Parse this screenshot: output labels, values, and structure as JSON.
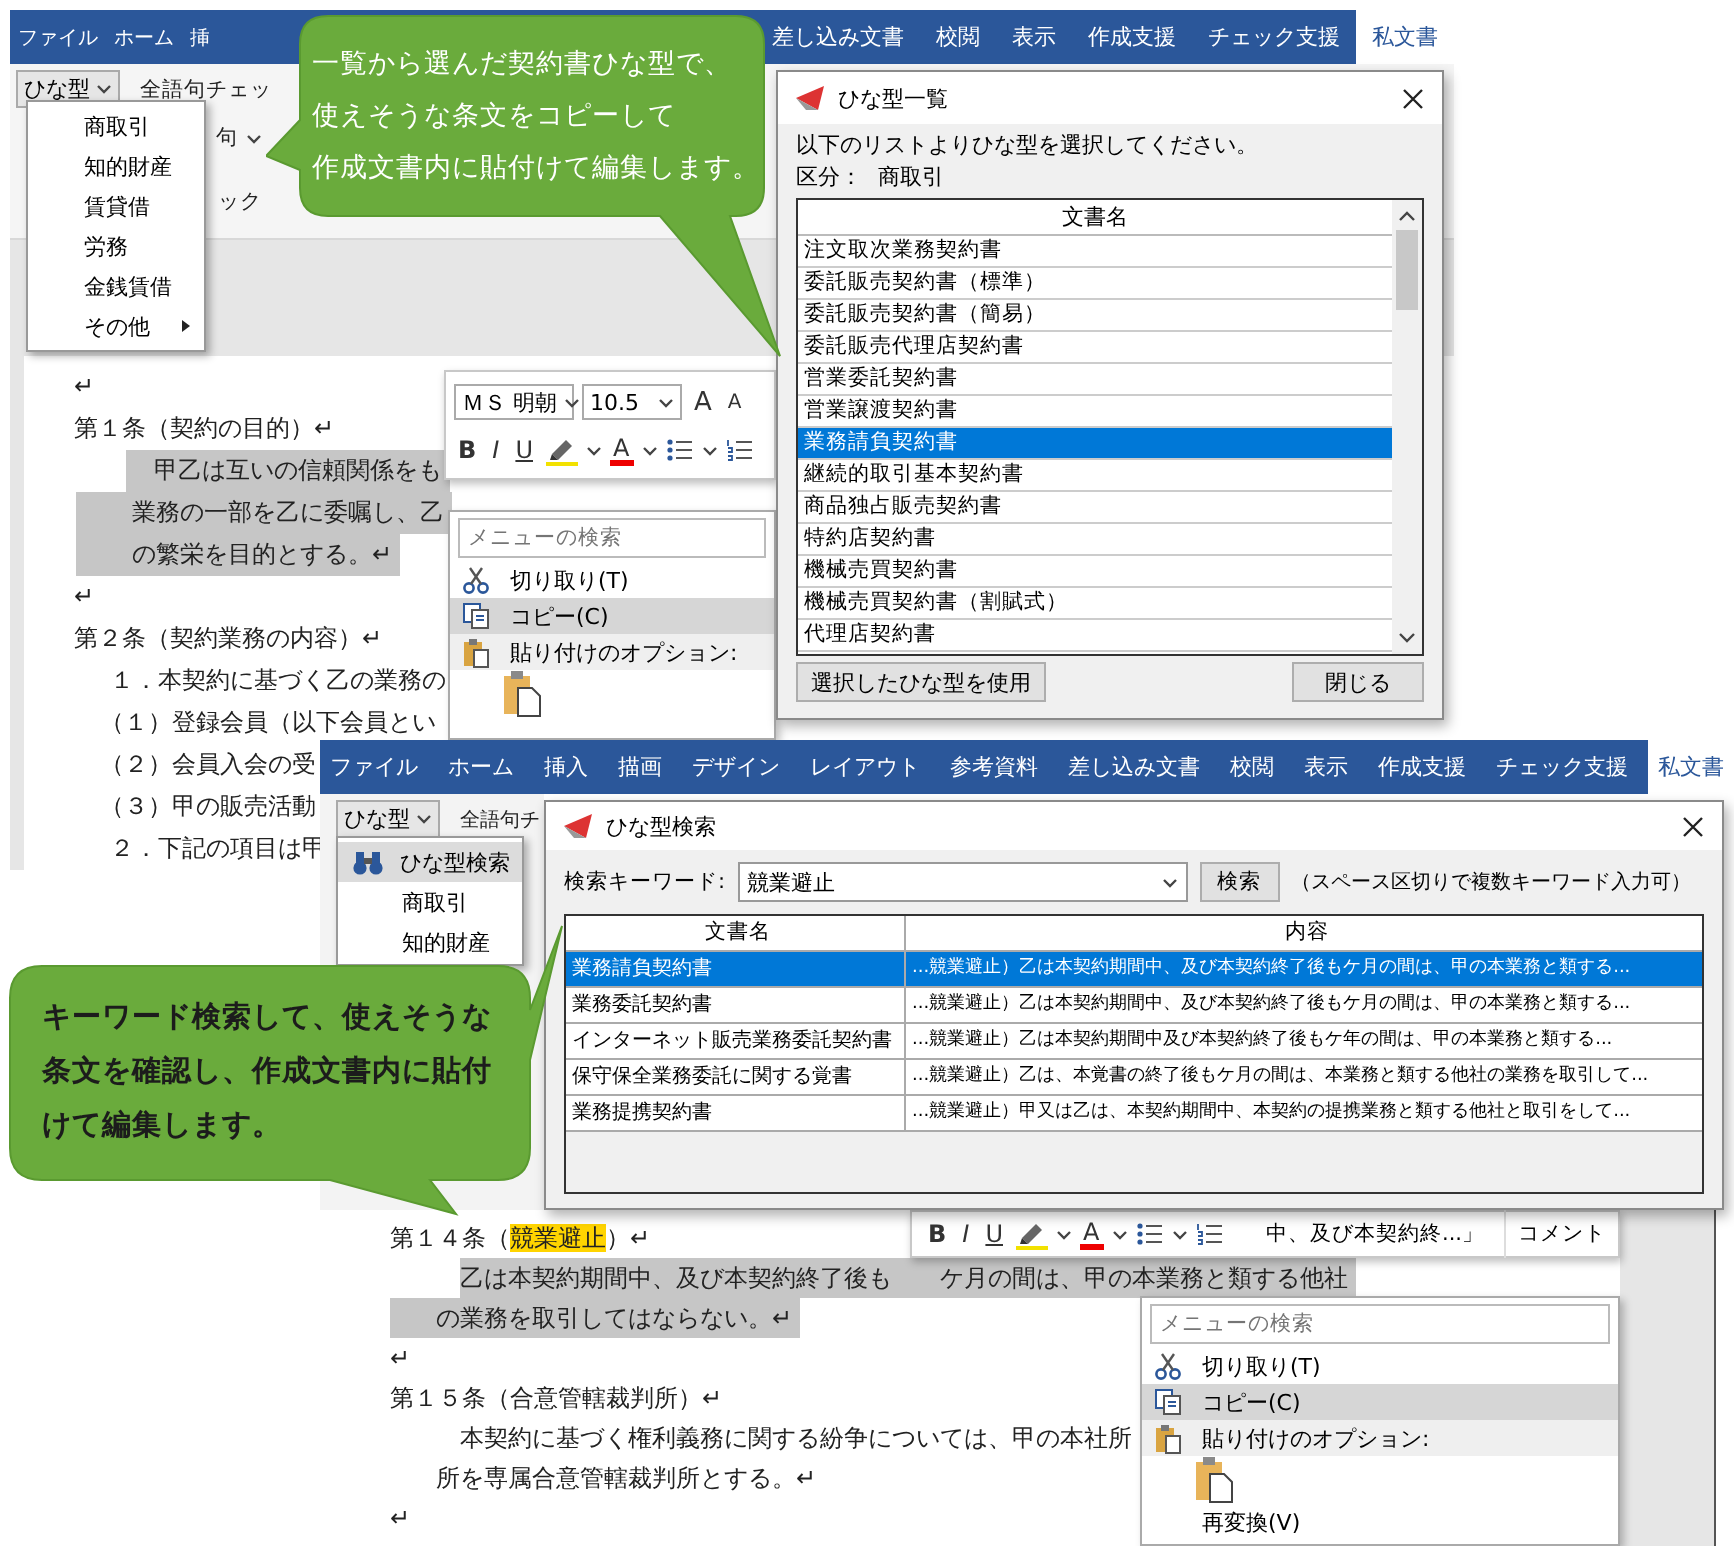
{
  "screen_top": {
    "ribbon_tabs_left": [
      {
        "label": "ファイル",
        "selected": false
      },
      {
        "label": "ホーム",
        "selected": false
      },
      {
        "label": "挿",
        "selected": false
      }
    ],
    "ribbon_tabs_right": [
      {
        "label": "差し込み文書",
        "selected": false
      },
      {
        "label": "校閲",
        "selected": false
      },
      {
        "label": "表示",
        "selected": false
      },
      {
        "label": "作成支援",
        "selected": false
      },
      {
        "label": "チェック支援",
        "selected": false
      },
      {
        "label": "私文書",
        "selected": true
      }
    ],
    "template_button": "ひな型",
    "ribbon_texts": [
      "全語句チェッ",
      "句",
      "ック"
    ],
    "template_menu": [
      {
        "label": "商取引",
        "selected": false,
        "submenu": false
      },
      {
        "label": "知的財産",
        "selected": false,
        "submenu": false
      },
      {
        "label": "賃貸借",
        "selected": false,
        "submenu": false
      },
      {
        "label": "労務",
        "selected": false,
        "submenu": false
      },
      {
        "label": "金銭賃借",
        "selected": false,
        "submenu": false
      },
      {
        "label": "その他",
        "selected": false,
        "submenu": true
      }
    ],
    "document_lines": [
      {
        "kind": "mark",
        "text": "↵",
        "selected": false
      },
      {
        "kind": "heading",
        "text": "第１条（契約の目的）↵",
        "selected": false
      },
      {
        "kind": "first",
        "text": "甲乙は互いの信頼関係をも",
        "selected": true
      },
      {
        "kind": "cont",
        "text": "業務の一部を乙に委嘱し、乙",
        "selected": true
      },
      {
        "kind": "cont",
        "text": "の繁栄を目的とする。↵",
        "selected": true
      },
      {
        "kind": "mark",
        "text": "↵",
        "selected": false
      },
      {
        "kind": "heading",
        "text": "第２条（契約業務の内容）↵",
        "selected": false
      },
      {
        "kind": "item",
        "text": "１．本契約に基づく乙の業務の",
        "selected": false
      },
      {
        "kind": "sub",
        "text": "（１）登録会員（以下会員とい",
        "selected": false
      },
      {
        "kind": "sub",
        "text": "（２）会員入会の受",
        "selected": false
      },
      {
        "kind": "sub",
        "text": "（３）甲の販売活動",
        "selected": false
      },
      {
        "kind": "item",
        "text": "２．下記の項目は甲",
        "selected": false
      }
    ],
    "mini_toolbar": {
      "font": "ＭＳ 明朝",
      "size": "10.5",
      "grow": "A",
      "shrink": "A",
      "styles": [
        "B",
        "I",
        "U"
      ],
      "font_color": "A"
    },
    "context_menu": {
      "search_placeholder": "メニューの検索",
      "items": [
        {
          "kind": "cut",
          "label": "切り取り(T)",
          "selected": false
        },
        {
          "kind": "copy",
          "label": "コピー(C)",
          "selected": true
        },
        {
          "kind": "paste",
          "label": "貼り付けのオプション:",
          "selected": false
        },
        {
          "kind": "paste-option",
          "selected": false
        }
      ]
    },
    "dialog": {
      "title": "ひな型一覧",
      "instruction": "以下のリストよりひな型を選択してください。",
      "category_label": "区分：",
      "category": "商取引",
      "column": "文書名",
      "rows": [
        {
          "name": "注文取次業務契約書",
          "selected": false
        },
        {
          "name": "委託販売契約書（標準）",
          "selected": false
        },
        {
          "name": "委託販売契約書（簡易）",
          "selected": false
        },
        {
          "name": "委託販売代理店契約書",
          "selected": false
        },
        {
          "name": "営業委託契約書",
          "selected": false
        },
        {
          "name": "営業譲渡契約書",
          "selected": false
        },
        {
          "name": "業務請負契約書",
          "selected": true
        },
        {
          "name": "継続的取引基本契約書",
          "selected": false
        },
        {
          "name": "商品独占販売契約書",
          "selected": false
        },
        {
          "name": "特約店契約書",
          "selected": false
        },
        {
          "name": "機械売買契約書",
          "selected": false
        },
        {
          "name": "機械売買契約書（割賦式）",
          "selected": false
        },
        {
          "name": "代理店契約書",
          "selected": false
        }
      ],
      "buttons": [
        "選択したひな型を使用",
        "閉じる"
      ]
    },
    "callout": [
      "一覧から選んだ契約書ひな型で、",
      "使えそうな条文をコピーして",
      "作成文書内に貼付けて編集します。"
    ]
  },
  "screen_bottom": {
    "ribbon_tabs": [
      {
        "label": "ファイル",
        "selected": false
      },
      {
        "label": "ホーム",
        "selected": false
      },
      {
        "label": "挿入",
        "selected": false
      },
      {
        "label": "描画",
        "selected": false
      },
      {
        "label": "デザイン",
        "selected": false
      },
      {
        "label": "レイアウト",
        "selected": false
      },
      {
        "label": "参考資料",
        "selected": false
      },
      {
        "label": "差し込み文書",
        "selected": false
      },
      {
        "label": "校閲",
        "selected": false
      },
      {
        "label": "表示",
        "selected": false
      },
      {
        "label": "作成支援",
        "selected": false
      },
      {
        "label": "チェック支援",
        "selected": false
      },
      {
        "label": "私文書",
        "selected": true
      }
    ],
    "template_button": "ひな型",
    "ribbon_text": "全語句チ",
    "template_menu": [
      {
        "kind": "search",
        "label": "ひな型検索",
        "selected": true
      },
      {
        "kind": "plain",
        "label": "商取引",
        "selected": false
      },
      {
        "kind": "plain",
        "label": "知的財産",
        "selected": false
      }
    ],
    "dialog": {
      "title": "ひな型検索",
      "keyword_label": "検索キーワード:",
      "keyword": "競業避止",
      "search_button": "検索",
      "hint": "（スペース区切りで複数キーワード入力可）",
      "columns": [
        "文書名",
        "内容"
      ],
      "rows": [
        {
          "cells": [
            "業務請負契約書",
            "...競業避止）乙は本契約期間中、及び本契約終了後もケ月の間は、甲の本業務と類する..."
          ],
          "selected": true
        },
        {
          "cells": [
            "業務委託契約書",
            "...競業避止）乙は本契約期間中、及び本契約終了後もケ月の間は、甲の本業務と類する..."
          ],
          "selected": false
        },
        {
          "cells": [
            "インターネット販売業務委託契約書",
            "...競業避止）乙は本契約期間中及び本契約終了後もケ年の間は、甲の本業務と類する..."
          ],
          "selected": false
        },
        {
          "cells": [
            "保守保全業務委託に関する覚書",
            "...競業避止）乙は、本覚書の終了後もケ月の間は、本業務と類する他社の業務を取引して..."
          ],
          "selected": false
        },
        {
          "cells": [
            "業務提携契約書",
            "...競業避止）甲又は乙は、本契約期間中、本契約の提携業務と類する他社と取引をして..."
          ],
          "selected": false
        }
      ]
    },
    "document_lines": [
      {
        "kind": "heading",
        "text": "第１４条（",
        "highlight": "競業避止",
        "after": "）↵",
        "selected": false
      },
      {
        "kind": "first",
        "text": "乙は本契約期間中、及び本契約終了後も　　ケ月の間は、甲の本業務と類する他社",
        "selected": true
      },
      {
        "kind": "cont",
        "text": "の業務を取引してはならない。↵",
        "selected": true
      },
      {
        "kind": "mark",
        "text": "↵",
        "selected": false
      },
      {
        "kind": "heading",
        "text": "第１５条（合意管轄裁判所）↵",
        "selected": false
      },
      {
        "kind": "first",
        "text": "本契約に基づく権利義務に関する紛争については、甲の本社所",
        "selected": false
      },
      {
        "kind": "cont",
        "text": "所を専属合意管轄裁判所とする。↵",
        "selected": false
      },
      {
        "kind": "mark",
        "text": "↵",
        "selected": false
      }
    ],
    "mini_toolbar": {
      "styles": [
        "B",
        "I",
        "U"
      ],
      "font_color": "A",
      "preview": "中、及び本契約終...」",
      "comment": "コメント"
    },
    "context_menu": {
      "search_placeholder": "メニューの検索",
      "items": [
        {
          "kind": "cut",
          "label": "切り取り(T)",
          "selected": false
        },
        {
          "kind": "copy",
          "label": "コピー(C)",
          "selected": true
        },
        {
          "kind": "paste",
          "label": "貼り付けのオプション:",
          "selected": false
        },
        {
          "kind": "paste-option",
          "selected": false
        },
        {
          "kind": "plain",
          "label": "再変換(V)",
          "selected": false
        }
      ]
    },
    "callout": [
      "キーワード検索して、使えそうな",
      "条文を確認し、作成文書内に貼付",
      "けて編集します。"
    ]
  }
}
